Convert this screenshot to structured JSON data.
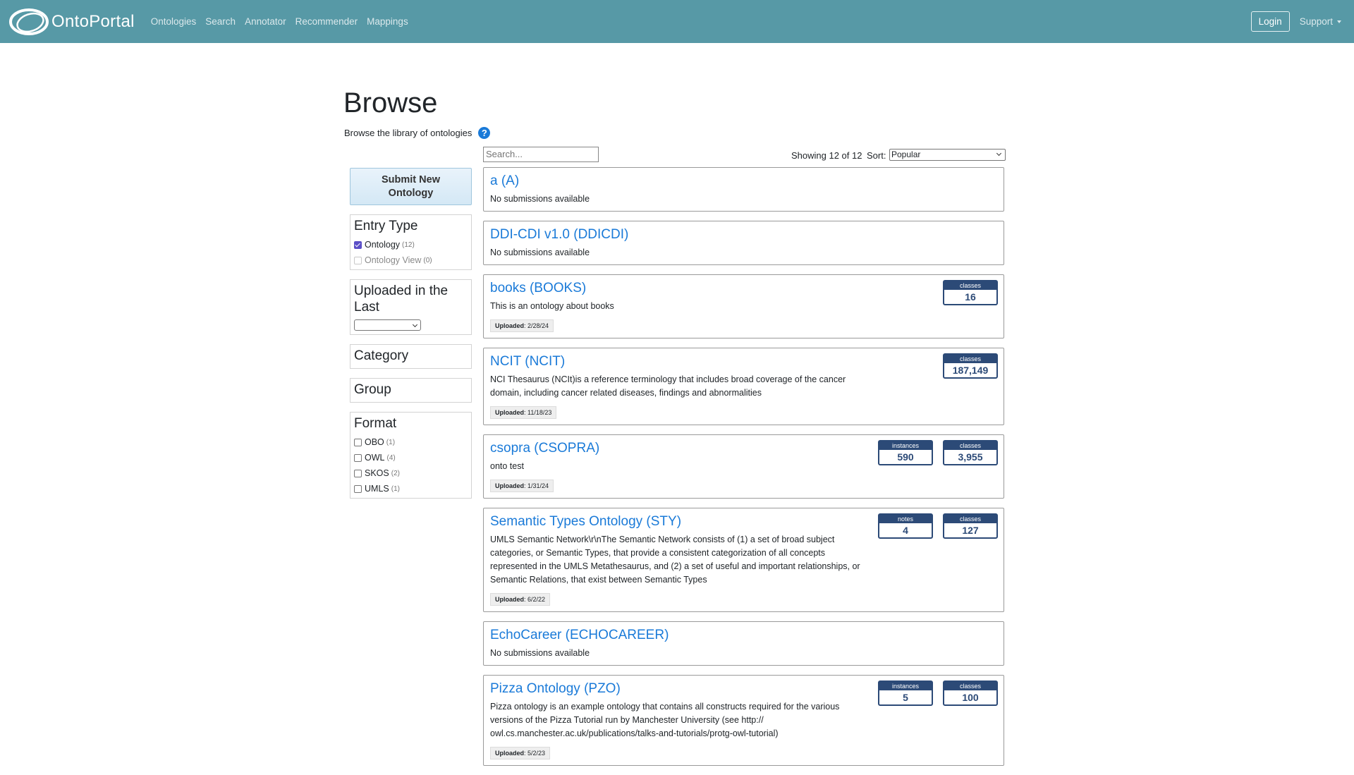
{
  "nav": {
    "brand": "OntoPortal",
    "links": [
      "Ontologies",
      "Search",
      "Annotator",
      "Recommender",
      "Mappings"
    ],
    "login": "Login",
    "support": "Support"
  },
  "header": {
    "title": "Browse",
    "subtitle": "Browse the library of ontologies"
  },
  "sidebar": {
    "submit_line1": "Submit New",
    "submit_line2": "Ontology",
    "entry_type": {
      "title": "Entry Type",
      "items": [
        {
          "label": "Ontology",
          "count": "(12)",
          "checked": true
        },
        {
          "label": "Ontology View",
          "count": "(0)",
          "checked": false
        }
      ]
    },
    "uploaded": {
      "title": "Uploaded in the Last",
      "value": ""
    },
    "category": {
      "title": "Category"
    },
    "group": {
      "title": "Group"
    },
    "format": {
      "title": "Format",
      "items": [
        {
          "label": "OBO",
          "count": "(1)"
        },
        {
          "label": "OWL",
          "count": "(4)"
        },
        {
          "label": "SKOS",
          "count": "(2)"
        },
        {
          "label": "UMLS",
          "count": "(1)"
        }
      ]
    }
  },
  "toolbar": {
    "search_placeholder": "Search...",
    "showing": "Showing 12 of 12",
    "sort_label": "Sort:",
    "sort_value": "Popular"
  },
  "ontologies": [
    {
      "title": "a (A)",
      "desc": "No submissions available",
      "uploaded": "",
      "metrics": []
    },
    {
      "title": "DDI-CDI v1.0 (DDICDI)",
      "desc": "No submissions available",
      "uploaded": "",
      "metrics": []
    },
    {
      "title": "books (BOOKS)",
      "desc": "This is an ontology about books",
      "uploaded": "2/28/24",
      "metrics": [
        {
          "label": "classes",
          "value": "16"
        }
      ]
    },
    {
      "title": "NCIT (NCIT)",
      "desc": "NCI Thesaurus (NCIt)is a reference terminology that includes broad coverage of the cancer domain, including cancer related diseases, findings and abnormalities",
      "uploaded": "11/18/23",
      "metrics": [
        {
          "label": "classes",
          "value": "187,149"
        }
      ]
    },
    {
      "title": "csopra (CSOPRA)",
      "desc": "onto test",
      "uploaded": "1/31/24",
      "metrics": [
        {
          "label": "instances",
          "value": "590"
        },
        {
          "label": "classes",
          "value": "3,955"
        }
      ]
    },
    {
      "title": "Semantic Types Ontology (STY)",
      "desc": "UMLS Semantic Network\\r\\nThe Semantic Network consists of (1) a set of broad subject categories, or Semantic Types, that provide a consistent categorization of all concepts represented in the UMLS Metathesaurus, and (2) a set of useful and important relationships, or Semantic Relations, that exist between Semantic Types",
      "uploaded": "6/2/22",
      "metrics": [
        {
          "label": "notes",
          "value": "4"
        },
        {
          "label": "classes",
          "value": "127"
        }
      ]
    },
    {
      "title": "EchoCareer (ECHOCAREER)",
      "desc": "No submissions available",
      "uploaded": "",
      "metrics": []
    },
    {
      "title": "Pizza Ontology (PZO)",
      "desc": "Pizza ontology is an example ontology that contains all constructs required for the various versions of the Pizza Tutorial run by Manchester University (see http:// owl.cs.manchester.ac.uk/publications/talks-and-tutorials/protg-owl-tutorial)",
      "uploaded": "5/2/23",
      "metrics": [
        {
          "label": "instances",
          "value": "5"
        },
        {
          "label": "classes",
          "value": "100"
        }
      ]
    }
  ],
  "labels": {
    "uploaded": "Uploaded"
  },
  "colors": {
    "navbar": "#5799a6",
    "link": "#1a7ad8",
    "metric": "#2c4a77"
  }
}
